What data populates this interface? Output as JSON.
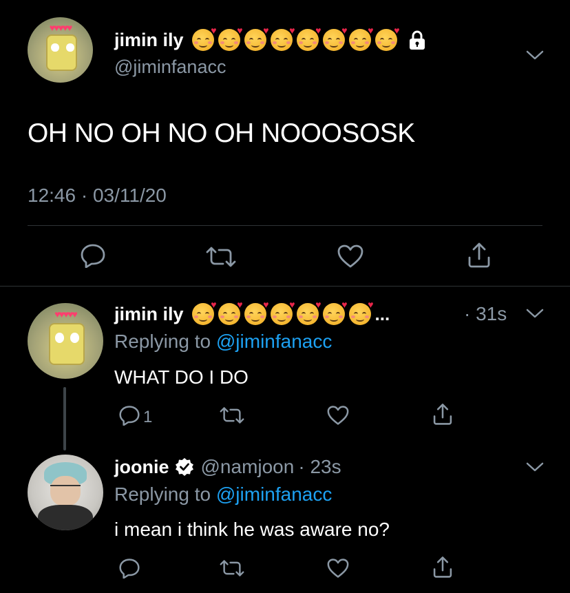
{
  "main_tweet": {
    "display_name": "jimin ily",
    "handle": "@jiminfanacc",
    "text": "OH NO OH NO OH NOOOSOSK",
    "timestamp": "12:46 · 03/11/20",
    "emoji_icon": "smiling-face-with-hearts-icon",
    "lock_icon": "lock-icon"
  },
  "reply1": {
    "display_name": "jimin ily",
    "ellipsis": "...",
    "time": "· 31s",
    "replying_prefix": "Replying to",
    "replying_handle": "@jiminfanacc",
    "text": "WHAT DO I DO",
    "reply_count": "1"
  },
  "reply2": {
    "display_name": "joonie",
    "handle": "@namjoon",
    "time": "· 23s",
    "replying_prefix": "Replying to",
    "replying_handle": "@jiminfanacc",
    "text": "i mean i think he was aware no?"
  },
  "colors": {
    "background": "#000000",
    "muted": "#8b98a5",
    "link": "#1da1f2"
  }
}
